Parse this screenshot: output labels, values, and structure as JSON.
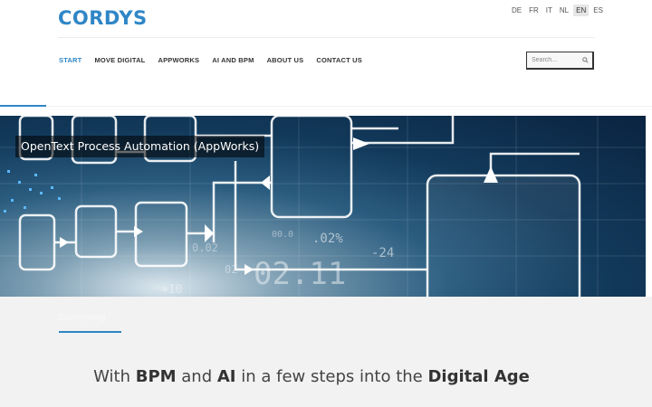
{
  "brand": {
    "logo_text": "CORDYS",
    "color": "#2f86c6"
  },
  "languages": [
    {
      "code": "DE",
      "active": false
    },
    {
      "code": "FR",
      "active": false
    },
    {
      "code": "IT",
      "active": false
    },
    {
      "code": "NL",
      "active": false
    },
    {
      "code": "EN",
      "active": true
    },
    {
      "code": "ES",
      "active": false
    }
  ],
  "nav": {
    "items": [
      {
        "label": "START",
        "active": true
      },
      {
        "label": "MOVE DIGITAL",
        "active": false
      },
      {
        "label": "APPWORKS",
        "active": false
      },
      {
        "label": "AI AND BPM",
        "active": false
      },
      {
        "label": "ABOUT US",
        "active": false
      },
      {
        "label": "CONTACT US",
        "active": false
      }
    ]
  },
  "search": {
    "placeholder": "Search...",
    "icon": "search-icon"
  },
  "hero": {
    "caption": "OpenText Process Automation (AppWorks)",
    "numbers": [
      "02.11",
      ".02%",
      "-24",
      "0.02",
      "00.0",
      "+10",
      "02"
    ]
  },
  "section": {
    "label": "Everything",
    "tagline": {
      "p1": "With ",
      "b1": "BPM",
      "p2": " and ",
      "b2": "AI",
      "p3": " in a few steps into the ",
      "b3": "Digital Age"
    }
  },
  "colors": {
    "accent": "#2f86c6",
    "lower_bg": "#f2f2f2"
  }
}
